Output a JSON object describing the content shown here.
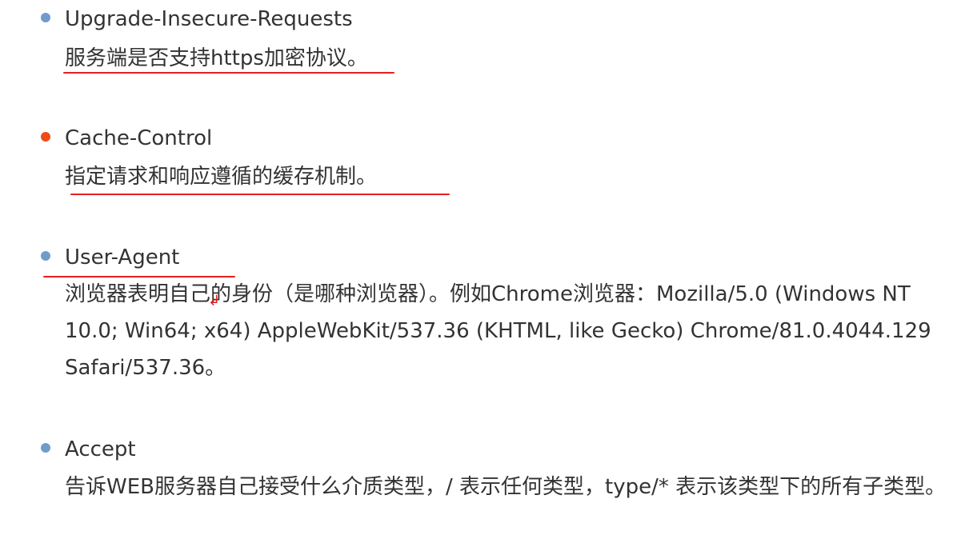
{
  "colors": {
    "bullet": "#6f9ccd",
    "bullet_active": "#f04a16",
    "text": "#333333",
    "annotation": "#e41f1f"
  },
  "items": [
    {
      "term": "Upgrade-Insecure-Requests",
      "description": "服务端是否支持https加密协议。"
    },
    {
      "term": "Cache-Control",
      "description": "指定请求和响应遵循的缓存机制。"
    },
    {
      "term": "User-Agent",
      "description": "浏览器表明自己的身份（是哪种浏览器）。例如Chrome浏览器：Mozilla/5.0 (Windows NT 10.0; Win64; x64) AppleWebKit/537.36 (KHTML, like Gecko) Chrome/81.0.4044.129 Safari/537.36。"
    },
    {
      "term": "Accept",
      "description": "告诉WEB服务器自己接受什么介质类型，/ 表示任何类型，type/* 表示该类型下的所有子类型。"
    }
  ]
}
